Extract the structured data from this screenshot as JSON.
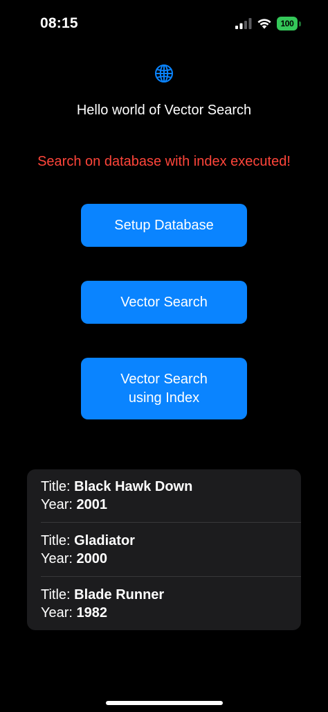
{
  "status_bar": {
    "time": "08:15",
    "battery_level": "100",
    "icons": [
      "signal-icon",
      "wifi-icon",
      "battery-icon"
    ],
    "battery_color": "#34c759"
  },
  "header": {
    "icon": "globe-icon",
    "greeting": "Hello world of Vector Search"
  },
  "status_message": {
    "text": "Search on database with index executed!",
    "color": "#ff453a"
  },
  "buttons": {
    "setup": "Setup Database",
    "vector_search": "Vector Search",
    "vector_search_index_line1": "Vector Search",
    "vector_search_index_line2": "using Index",
    "color": "#0a84ff"
  },
  "results": {
    "title_label": "Title:",
    "year_label": "Year:",
    "items": [
      {
        "title": "Black Hawk Down",
        "year": "2001"
      },
      {
        "title": "Gladiator",
        "year": "2000"
      },
      {
        "title": "Blade Runner",
        "year": "1982"
      }
    ]
  }
}
